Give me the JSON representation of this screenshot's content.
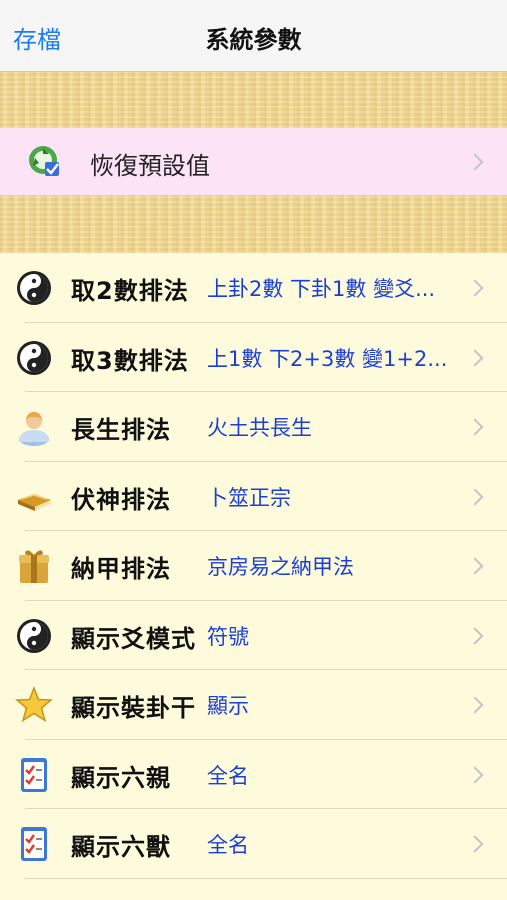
{
  "navbar": {
    "left_button": "存檔",
    "title": "系統參數"
  },
  "restore": {
    "label": "恢復預設值",
    "icon": "recycle-icon"
  },
  "rows": [
    {
      "icon": "yin-yang-icon",
      "label": "取2數排法",
      "value": "上卦2數 下卦1數 變爻..."
    },
    {
      "icon": "yin-yang-icon",
      "label": "取3數排法",
      "value": "上1數 下2+3數 變1+2..."
    },
    {
      "icon": "person-icon",
      "label": "長生排法",
      "value": "火土共長生"
    },
    {
      "icon": "book-icon",
      "label": "伏神排法",
      "value": "卜筮正宗"
    },
    {
      "icon": "gift-box-icon",
      "label": "納甲排法",
      "value": "京房易之納甲法"
    },
    {
      "icon": "yin-yang-icon",
      "label": "顯示爻模式",
      "value": "符號"
    },
    {
      "icon": "star-icon",
      "label": "顯示裝卦干",
      "value": "顯示"
    },
    {
      "icon": "checklist-icon",
      "label": "顯示六親",
      "value": "全名"
    },
    {
      "icon": "checklist-icon",
      "label": "顯示六獸",
      "value": "全名"
    }
  ]
}
